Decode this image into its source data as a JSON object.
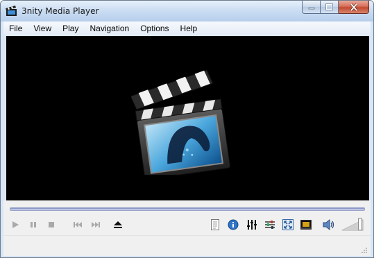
{
  "window": {
    "title": "3nity Media Player",
    "minimize": "minimize",
    "maximize": "maximize",
    "close": "close"
  },
  "menu": {
    "items": [
      "File",
      "View",
      "Play",
      "Navigation",
      "Options",
      "Help"
    ]
  },
  "video": {
    "placeholder_icon": "clapperboard-logo"
  },
  "controls": {
    "seek_progress": 0,
    "buttons": [
      {
        "name": "play",
        "icon": "play-icon",
        "enabled": false
      },
      {
        "name": "pause",
        "icon": "pause-icon",
        "enabled": false
      },
      {
        "name": "stop",
        "icon": "stop-icon",
        "enabled": false
      },
      {
        "name": "previous",
        "icon": "skip-back-icon",
        "enabled": false
      },
      {
        "name": "next",
        "icon": "skip-forward-icon",
        "enabled": false
      },
      {
        "name": "eject",
        "icon": "eject-icon",
        "enabled": true
      },
      {
        "name": "playlist",
        "icon": "playlist-icon",
        "enabled": true
      },
      {
        "name": "info",
        "icon": "info-icon",
        "enabled": true
      },
      {
        "name": "equalizer",
        "icon": "equalizer-icon",
        "enabled": true
      },
      {
        "name": "settings",
        "icon": "sliders-icon",
        "enabled": true
      },
      {
        "name": "fullscreen",
        "icon": "fullscreen-icon",
        "enabled": true
      },
      {
        "name": "compact",
        "icon": "compact-view-icon",
        "enabled": true
      },
      {
        "name": "mute",
        "icon": "speaker-icon",
        "enabled": true
      }
    ],
    "volume_level": 0.85
  },
  "colors": {
    "accent": "#1f5fae",
    "disabled": "#a9a9a9",
    "seek": "#9aa4c9"
  }
}
